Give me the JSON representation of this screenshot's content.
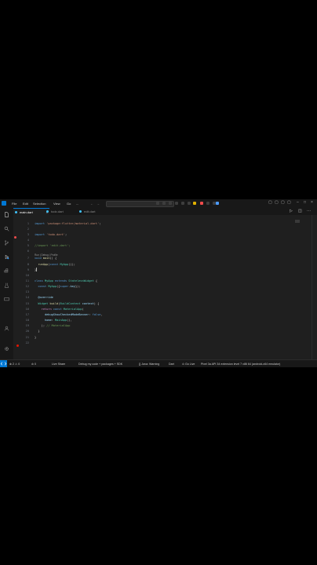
{
  "menu": [
    "File",
    "Edit",
    "Selection",
    "View",
    "Go",
    "..."
  ],
  "tabs": [
    {
      "label": "main.dart",
      "active": true,
      "close": "×"
    },
    {
      "label": "todo.dart",
      "active": false
    },
    {
      "label": "edit.dart",
      "active": false
    }
  ],
  "editor": {
    "lines": [
      {
        "n": "1",
        "parts": [
          [
            "kw",
            "import "
          ],
          [
            "str",
            "'package:flutter/material.dart'"
          ],
          [
            "txt",
            ";"
          ]
        ]
      },
      {
        "n": "2",
        "parts": []
      },
      {
        "n": "3",
        "parts": [
          [
            "kw",
            "import "
          ],
          [
            "str",
            "'todo.dart'"
          ],
          [
            "txt",
            ";"
          ]
        ]
      },
      {
        "n": "4",
        "parts": []
      },
      {
        "n": "5",
        "parts": [
          [
            "cmt",
            "//import 'edit.dart';"
          ]
        ]
      },
      {
        "n": "6",
        "parts": []
      },
      {
        "n": "7",
        "parts": [
          [
            "kw",
            "void "
          ],
          [
            "fn",
            "main"
          ],
          [
            "txt",
            "() {"
          ]
        ]
      },
      {
        "n": "8",
        "parts": [
          [
            "txt",
            "  "
          ],
          [
            "fn",
            "runApp"
          ],
          [
            "txt",
            "("
          ],
          [
            "kw",
            "const "
          ],
          [
            "cls",
            "MyApp"
          ],
          [
            "txt",
            "());"
          ]
        ]
      },
      {
        "n": "9",
        "parts": [
          [
            "txt",
            "}"
          ]
        ]
      },
      {
        "n": "10",
        "parts": []
      },
      {
        "n": "11",
        "parts": [
          [
            "kw",
            "class "
          ],
          [
            "cls",
            "MyApp "
          ],
          [
            "kw",
            "extends "
          ],
          [
            "cls",
            "StatelessWidget"
          ],
          [
            "txt",
            " {"
          ]
        ]
      },
      {
        "n": "12",
        "parts": [
          [
            "txt",
            "  "
          ],
          [
            "kw",
            "const "
          ],
          [
            "cls",
            "MyApp"
          ],
          [
            "txt",
            "({"
          ],
          [
            "kw",
            "super"
          ],
          [
            "txt",
            "."
          ],
          [
            "prop",
            "key"
          ],
          [
            "txt",
            "});"
          ]
        ]
      },
      {
        "n": "13",
        "parts": []
      },
      {
        "n": "14",
        "parts": [
          [
            "txt",
            "  "
          ],
          [
            "prop",
            "@override"
          ]
        ]
      },
      {
        "n": "15",
        "parts": [
          [
            "txt",
            "  "
          ],
          [
            "cls",
            "Widget "
          ],
          [
            "fn",
            "build"
          ],
          [
            "txt",
            "("
          ],
          [
            "cls",
            "BuildContext "
          ],
          [
            "prop",
            "context"
          ],
          [
            "txt",
            ") {"
          ]
        ]
      },
      {
        "n": "16",
        "parts": [
          [
            "txt",
            "    "
          ],
          [
            "ctrl",
            "return "
          ],
          [
            "kw",
            "const "
          ],
          [
            "cls",
            "MaterialApp"
          ],
          [
            "txt",
            "("
          ]
        ]
      },
      {
        "n": "17",
        "parts": [
          [
            "txt",
            "      "
          ],
          [
            "prop",
            "debugShowCheckedModeBanner"
          ],
          [
            "txt",
            ": "
          ],
          [
            "kw",
            "false"
          ],
          [
            "txt",
            ","
          ]
        ]
      },
      {
        "n": "18",
        "parts": [
          [
            "txt",
            "      "
          ],
          [
            "prop",
            "home"
          ],
          [
            "txt",
            ": "
          ],
          [
            "cls",
            "MainApp"
          ],
          [
            "txt",
            "(),"
          ]
        ]
      },
      {
        "n": "19",
        "parts": [
          [
            "txt",
            "    ); "
          ],
          [
            "cmt",
            "// MaterialApp"
          ]
        ]
      },
      {
        "n": "20",
        "parts": [
          [
            "txt",
            "  }"
          ]
        ]
      },
      {
        "n": "21",
        "parts": [
          [
            "txt",
            "}"
          ]
        ]
      },
      {
        "n": "22",
        "parts": []
      }
    ],
    "codelens": "Run | Debug | Profile"
  },
  "statusbar": {
    "left": [
      "⊗ 2 ⚠ 0",
      "⊘ 0",
      "Live Share",
      "Debug my code + packages + SDK",
      "{} Java: Warning",
      "Dart",
      "⊙ Go Live"
    ],
    "right": "Pixel 3a API 34 extension level 7 x86 64 (android-x64 emulator)"
  },
  "colors": {
    "accent": "#0078d4",
    "background": "#1f1f1f"
  }
}
